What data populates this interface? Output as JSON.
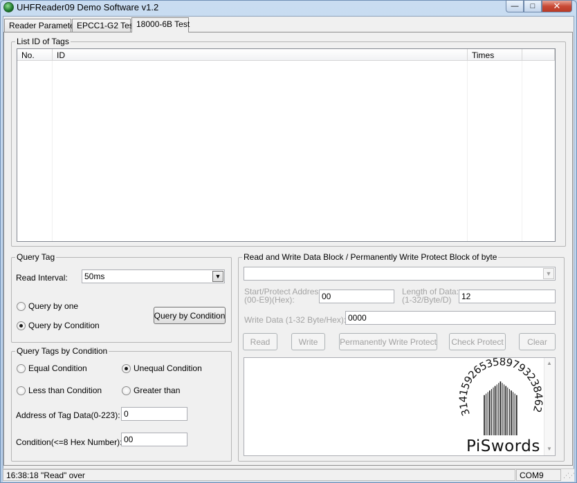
{
  "window": {
    "title": "UHFReader09 Demo Software v1.2",
    "minimize_glyph": "—",
    "maximize_glyph": "□",
    "close_glyph": "✕"
  },
  "tabs": [
    {
      "label": "Reader Parameter",
      "active": false
    },
    {
      "label": "EPCC1-G2 Test",
      "active": false
    },
    {
      "label": "18000-6B Test",
      "active": true
    }
  ],
  "list_group": {
    "title": "List ID of Tags",
    "columns": [
      "No.",
      "ID",
      "Times"
    ],
    "rows": []
  },
  "query_tag": {
    "title": "Query Tag",
    "read_interval_label": "Read Interval:",
    "read_interval_value": "50ms",
    "query_by_one_label": "Query by one",
    "query_by_condition_label": "Query by Condition",
    "selected_mode": "Query by Condition",
    "query_button_label": "Query by Condition"
  },
  "query_condition": {
    "title": "Query Tags by Condition",
    "equal_label": "Equal Condition",
    "unequal_label": "Unequal Condition",
    "less_label": "Less than Condition",
    "greater_label": "Greater than",
    "selected": "Unequal Condition",
    "address_label": "Address of Tag Data(0-223):",
    "address_value": "0",
    "condition_label": "Condition(<=8 Hex Number):",
    "condition_value": "00"
  },
  "read_write": {
    "title": "Read and Write Data Block / Permanently Write  Protect Block of  byte",
    "tag_select_value": "",
    "start_address_label_line1": "Start/Protect Address",
    "start_address_label_line2": "(00-E9)(Hex):",
    "start_address_value": "00",
    "length_label_line1": "Length of Data:",
    "length_label_line2": "(1-32/Byte/D)",
    "length_value": "12",
    "write_data_label": "Write Data (1-32 Byte/Hex):",
    "write_data_value": "0000",
    "read_button": "Read",
    "write_button": "Write",
    "protect_button": "Permanently Write  Protect",
    "check_protect_button": "Check Protect",
    "clear_button": "Clear"
  },
  "logo": {
    "name": "PiSwords",
    "digits": "3141592653589793238462"
  },
  "status": {
    "message": "16:38:18 \"Read\" over",
    "port": "COM9"
  },
  "colors": {
    "accent_title_bar": "#c9dcf1",
    "close_button": "#c94a36",
    "disabled_text": "#a3a3a3"
  }
}
